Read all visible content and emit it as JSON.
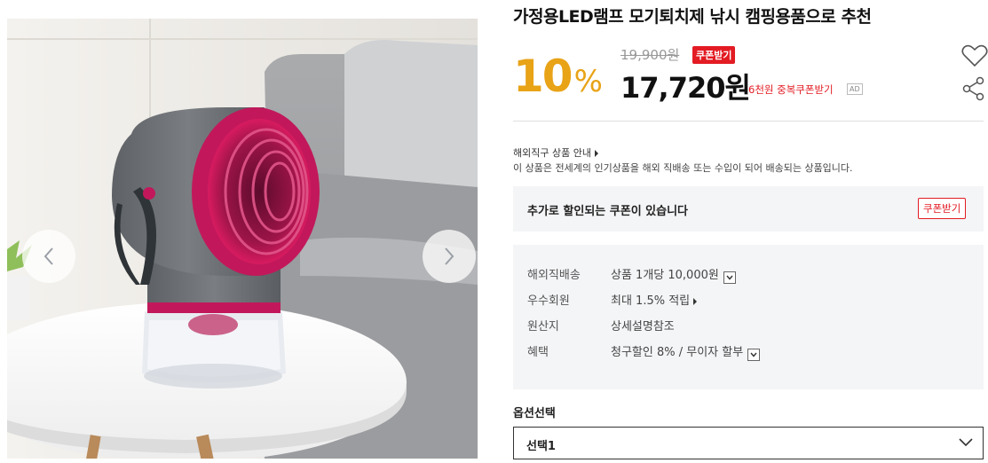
{
  "product": {
    "title": "가정용LED램프 모기퇴치제 낚시 캠핑용품으로 추천"
  },
  "price": {
    "discount_value": "10",
    "discount_unit": "%",
    "original": "19,900원",
    "coupon_tag": "쿠폰받기",
    "sale": "17,720원",
    "coupon_info": "6천원 중복쿠폰받기",
    "ad_badge": "AD"
  },
  "overseas": {
    "title": "해외직구 상품 안내",
    "description": "이 상품은 전세계의 인기상품을 해외 직배송 또는 수입이 되어 배송되는 상품입니다."
  },
  "coupon_box": {
    "text": "추가로 할인되는 쿠폰이 있습니다",
    "button": "쿠폰받기"
  },
  "specs": [
    {
      "label": "해외직배송",
      "value": "상품 1개당 10,000원"
    },
    {
      "label": "우수회원",
      "value": "최대 1.5% 적립"
    },
    {
      "label": "원산지",
      "value": "상세설명참조"
    },
    {
      "label": "혜택",
      "value": "청구할인 8% / 무이자 할부"
    }
  ],
  "option": {
    "label": "옵션선택",
    "selected": "선택1"
  },
  "icons": {
    "prev": "chevron-left-icon",
    "next": "chevron-right-icon",
    "wishlist": "heart-icon",
    "share": "share-icon",
    "dropdown": "chevron-down-icon"
  },
  "colors": {
    "discount": "#e8a317",
    "accent_red": "#e31b23",
    "lamp_body": "#6d7175",
    "lamp_ring": "#c2185b"
  }
}
